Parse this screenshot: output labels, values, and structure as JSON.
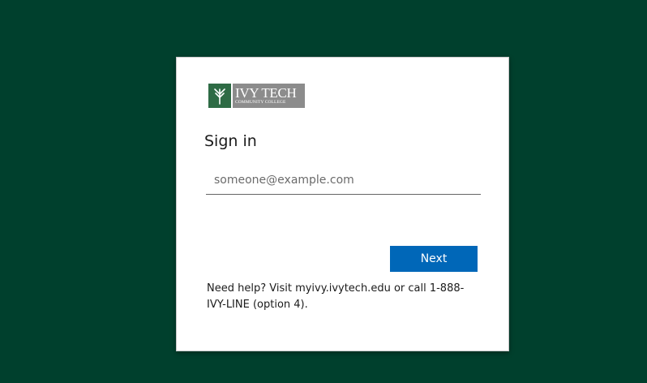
{
  "colors": {
    "background": "#00402d",
    "card": "#ffffff",
    "button": "#0067b8",
    "logo_mark": "#2e6b45",
    "logo_text_bg": "#8c8c8c"
  },
  "logo": {
    "icon": "ivy-leaf-icon",
    "name": "IVY TECH",
    "subtitle": "COMMUNITY COLLEGE"
  },
  "signin": {
    "title": "Sign in",
    "email_placeholder": "someone@example.com",
    "email_value": "",
    "next_label": "Next",
    "help_text": "Need help? Visit myivy.ivytech.edu or call 1-888-IVY-LINE (option 4)."
  }
}
